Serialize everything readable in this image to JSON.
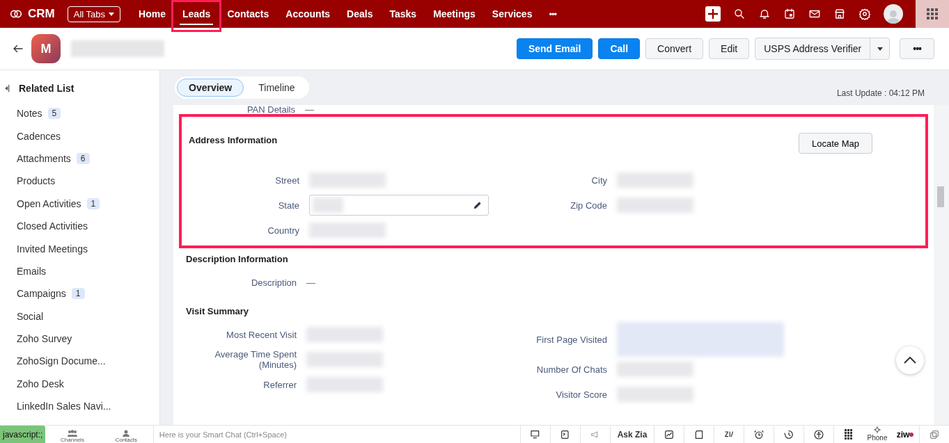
{
  "nav": {
    "brand": "CRM",
    "all_tabs": "All Tabs",
    "more": "•••",
    "tabs": [
      {
        "label": "Home",
        "selected": false,
        "highlighted": false
      },
      {
        "label": "Leads",
        "selected": true,
        "highlighted": true
      },
      {
        "label": "Contacts",
        "selected": false,
        "highlighted": false
      },
      {
        "label": "Accounts",
        "selected": false,
        "highlighted": false
      },
      {
        "label": "Deals",
        "selected": false,
        "highlighted": false
      },
      {
        "label": "Tasks",
        "selected": false,
        "highlighted": false
      },
      {
        "label": "Meetings",
        "selected": false,
        "highlighted": false
      },
      {
        "label": "Services",
        "selected": false,
        "highlighted": false
      }
    ]
  },
  "record": {
    "avatar": "M",
    "buttons": [
      {
        "label": "Send Email",
        "kind": "primary"
      },
      {
        "label": "Call",
        "kind": "primary"
      },
      {
        "label": "Convert",
        "kind": "secondary"
      },
      {
        "label": "Edit",
        "kind": "secondary"
      },
      {
        "label": "USPS Address Verifier",
        "kind": "split"
      },
      {
        "label": "•••",
        "kind": "more"
      }
    ]
  },
  "sidebar": {
    "title": "Related List",
    "items": [
      {
        "label": "Notes",
        "count": "5"
      },
      {
        "label": "Cadences"
      },
      {
        "label": "Attachments",
        "count": "6"
      },
      {
        "label": "Products"
      },
      {
        "label": "Open Activities",
        "count": "1"
      },
      {
        "label": "Closed Activities"
      },
      {
        "label": "Invited Meetings"
      },
      {
        "label": "Emails"
      },
      {
        "label": "Campaigns",
        "count": "1"
      },
      {
        "label": "Social"
      },
      {
        "label": "Zoho Survey"
      },
      {
        "label": "ZohoSign Docume..."
      },
      {
        "label": "Zoho Desk"
      },
      {
        "label": "LinkedIn Sales Navi..."
      }
    ]
  },
  "view_tabs": [
    {
      "label": "Overview",
      "selected": true
    },
    {
      "label": "Timeline",
      "selected": false
    }
  ],
  "last_update": "Last Update : 04:12 PM",
  "top_field": {
    "label": "PAN Details",
    "value": "—"
  },
  "sections": [
    {
      "title": "Address Information",
      "highlighted": true,
      "action": "Locate Map",
      "left": [
        {
          "label": "Street",
          "kind": "blurred"
        },
        {
          "label": "State",
          "kind": "editing"
        },
        {
          "label": "Country",
          "kind": "blurred"
        }
      ],
      "right": [
        {
          "label": "City",
          "kind": "blurred"
        },
        {
          "label": "Zip Code",
          "kind": "blurred"
        }
      ]
    },
    {
      "title": "Description Information",
      "highlighted": false,
      "left": [
        {
          "label": "Description",
          "kind": "text",
          "value": "—"
        }
      ]
    },
    {
      "title": "Visit Summary",
      "highlighted": false,
      "left": [
        {
          "label": "Most Recent Visit",
          "kind": "blurred"
        },
        {
          "label": "Average Time Spent (Minutes)",
          "kind": "blurred"
        },
        {
          "label": "Referrer",
          "kind": "blurred"
        }
      ],
      "right": [
        {
          "label": "First Page Visited",
          "kind": "blurred_tall"
        },
        {
          "label": "Number Of Chats",
          "kind": "blurred"
        },
        {
          "label": "Visitor Score",
          "kind": "blurred"
        }
      ]
    }
  ],
  "bottom": {
    "status": "javascript:;",
    "channels": "Channels",
    "contacts": "Contacts",
    "chat_placeholder": "Here is your Smart Chat (Ctrl+Space)",
    "ask_zia": "Ask Zia",
    "phone": "Phone",
    "ziwo": "ziw"
  }
}
